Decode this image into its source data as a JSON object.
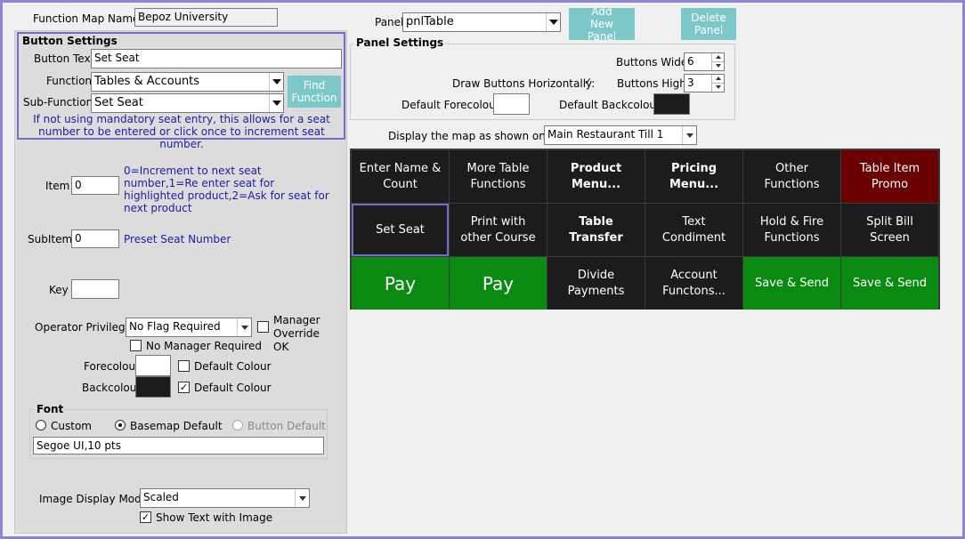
{
  "header": {
    "function_map_label": "Function Map Name:",
    "function_map_value": "Bepoz University",
    "panel_label": "Panel",
    "panel_value": "pnlTable",
    "add_panel_label": "Add New Panel",
    "delete_panel_label": "Delete Panel"
  },
  "button_settings": {
    "title": "Button Settings",
    "button_text_label": "Button Text",
    "button_text_value": "Set Seat",
    "function_label": "Function",
    "function_value": "Tables & Accounts",
    "subfunction_label": "Sub-Function",
    "subfunction_value": "Set Seat",
    "find_function_label": "Find Function",
    "info_text": "If not using mandatory seat entry, this allows for a seat number to be entered or click once to increment seat number."
  },
  "props": {
    "item_label": "Item",
    "item_value": "0",
    "item_hint": "0=Increment to next seat number,1=Re enter seat for highlighted product,2=Ask for seat for next product",
    "subitem_label": "SubItem",
    "subitem_value": "0",
    "subitem_hint": "Preset Seat Number",
    "key_label": "Key",
    "key_value": "",
    "operator_privilege_label": "Operator Privilege:",
    "operator_privilege_value": "No Flag Required",
    "manager_override_label": "Manager Override OK",
    "manager_override_checked": false,
    "no_manager_required_label": "No Manager Required",
    "no_manager_required_checked": false,
    "forecolour_label": "Forecolour",
    "forecolour_default_label": "Default Colour",
    "forecolour_default_checked": false,
    "backcolour_label": "Backcolour",
    "backcolour_default_label": "Default Colour",
    "backcolour_default_checked": true,
    "forecolour_swatch": "#ffffff",
    "backcolour_swatch": "#1c1c1c"
  },
  "font": {
    "title": "Font",
    "custom_label": "Custom",
    "basemap_label": "Basemap Default",
    "button_default_label": "Button Default",
    "selected": "Basemap Default",
    "font_value": "Segoe UI,10 pts"
  },
  "image": {
    "display_mode_label": "Image Display Mode:",
    "display_mode_value": "Scaled",
    "show_text_label": "Show Text with Image",
    "show_text_checked": true
  },
  "panel_settings": {
    "title": "Panel Settings",
    "buttons_wide_label": "Buttons Wide:",
    "buttons_wide_value": "6",
    "buttons_high_label": "Buttons High:",
    "buttons_high_value": "3",
    "draw_horiz_label": "Draw Buttons Horizontally:",
    "draw_horiz_checked": true,
    "default_fore_label": "Default Forecolour",
    "default_back_label": "Default Backcolour",
    "default_fore_swatch": "#ffffff",
    "default_back_swatch": "#1c1c1c"
  },
  "display_map": {
    "label": "Display the map as shown on till:",
    "value": "Main Restaurant Till 1"
  },
  "tiles": [
    {
      "label": "Enter Name & Count",
      "style": "normal"
    },
    {
      "label": "More Table Functions",
      "style": "normal"
    },
    {
      "label": "Product Menu...",
      "style": "bold"
    },
    {
      "label": "Pricing Menu...",
      "style": "bold"
    },
    {
      "label": "Other Functions",
      "style": "normal"
    },
    {
      "label": "Table Item Promo",
      "style": "red"
    },
    {
      "label": "Set Seat",
      "style": "selected"
    },
    {
      "label": "Print with other Course",
      "style": "normal"
    },
    {
      "label": "Table Transfer",
      "style": "bold"
    },
    {
      "label": "Text Condiment",
      "style": "normal"
    },
    {
      "label": "Hold & Fire Functions",
      "style": "normal"
    },
    {
      "label": "Split Bill Screen",
      "style": "normal"
    },
    {
      "label": "Pay",
      "style": "green-big"
    },
    {
      "label": "Pay",
      "style": "green-big"
    },
    {
      "label": "Divide Payments",
      "style": "normal"
    },
    {
      "label": "Account Functons...",
      "style": "normal"
    },
    {
      "label": "Save & Send",
      "style": "green"
    },
    {
      "label": "Save & Send",
      "style": "green"
    }
  ],
  "colors": {
    "accent_border": "#6f6fc8",
    "teal_button": "#7cc8c8",
    "tile_dark": "#1c1c1c",
    "tile_green": "#0b8a12",
    "tile_red": "#6b0000",
    "info_blue": "#1c1ca8"
  }
}
